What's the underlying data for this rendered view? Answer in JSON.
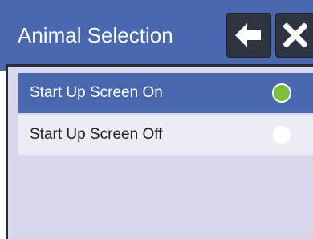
{
  "header": {
    "title": "Animal Selection",
    "back_icon": "arrow-left-icon",
    "close_icon": "close-x-icon"
  },
  "options": [
    {
      "label": "Start Up Screen On",
      "selected": true
    },
    {
      "label": "Start Up Screen Off",
      "selected": false
    }
  ],
  "colors": {
    "header_bg": "#4a68b0",
    "selected_row_bg": "#4a68b0",
    "unselected_row_bg": "#ececf5",
    "panel_bg": "#d8d8ec",
    "button_bg": "#2f3540",
    "radio_on": "#7cbf3a",
    "radio_off": "#ffffff"
  }
}
